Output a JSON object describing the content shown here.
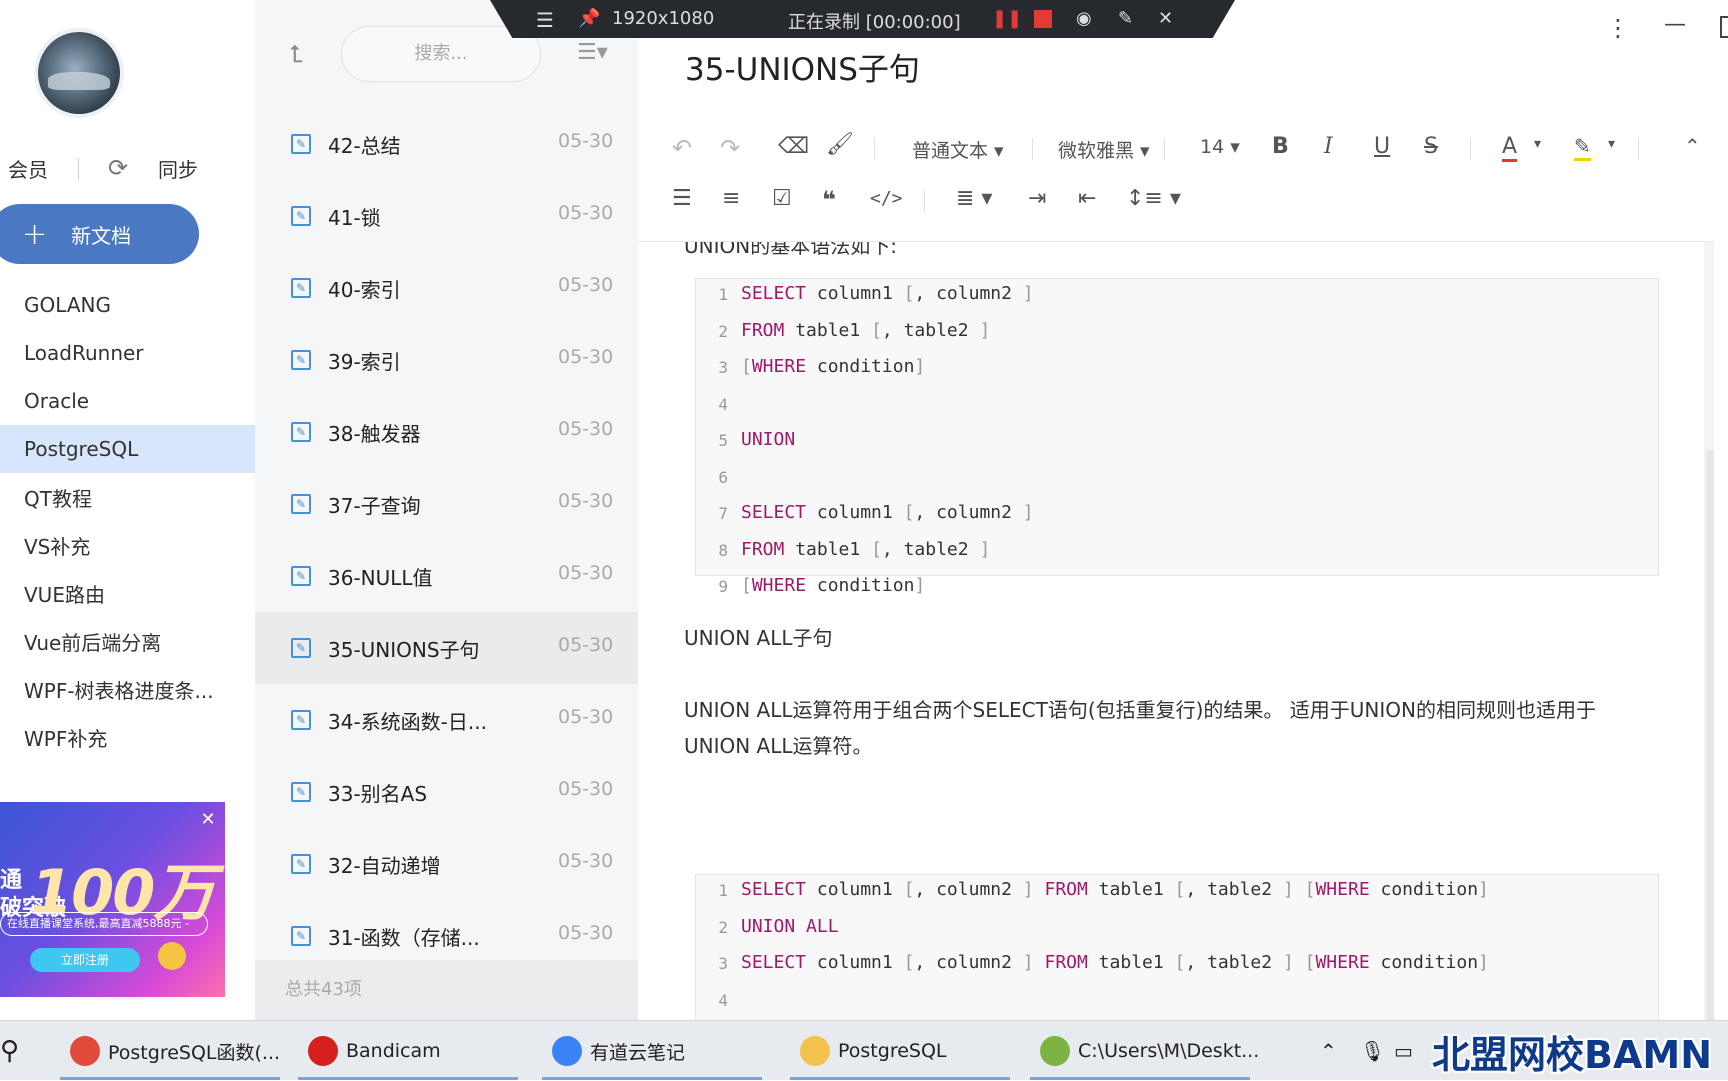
{
  "recorder": {
    "resolution": "1920x1080",
    "status": "正在录制 [00:00:00]"
  },
  "sidebar": {
    "member": "会员",
    "sync": "同步",
    "new_doc": "新文档",
    "notebooks": [
      {
        "label": "GOLANG",
        "selected": false
      },
      {
        "label": "LoadRunner",
        "selected": false
      },
      {
        "label": "Oracle",
        "selected": false
      },
      {
        "label": "PostgreSQL",
        "selected": true
      },
      {
        "label": "QT教程",
        "selected": false
      },
      {
        "label": "VS补充",
        "selected": false
      },
      {
        "label": "VUE路由",
        "selected": false
      },
      {
        "label": "Vue前后端分离",
        "selected": false
      },
      {
        "label": "WPF-树表格进度条...",
        "selected": false
      },
      {
        "label": "WPF补充",
        "selected": false
      }
    ],
    "ad": {
      "big": "100万",
      "line1": "通",
      "line2": "破突破",
      "small": "在线直播课堂系统,最高直减5888元 -",
      "button": "立即注册"
    }
  },
  "notelist": {
    "search_placeholder": "搜索...",
    "items": [
      {
        "title": "42-总结",
        "date": "05-30",
        "selected": false
      },
      {
        "title": "41-锁",
        "date": "05-30",
        "selected": false
      },
      {
        "title": "40-索引",
        "date": "05-30",
        "selected": false
      },
      {
        "title": "39-索引",
        "date": "05-30",
        "selected": false
      },
      {
        "title": "38-触发器",
        "date": "05-30",
        "selected": false
      },
      {
        "title": "37-子查询",
        "date": "05-30",
        "selected": false
      },
      {
        "title": "36-NULL值",
        "date": "05-30",
        "selected": false
      },
      {
        "title": "35-UNIONS子句",
        "date": "05-30",
        "selected": true
      },
      {
        "title": "34-系统函数-日...",
        "date": "05-30",
        "selected": false
      },
      {
        "title": "33-别名AS",
        "date": "05-30",
        "selected": false
      },
      {
        "title": "32-自动递增",
        "date": "05-30",
        "selected": false
      },
      {
        "title": "31-函数（存储...",
        "date": "05-30",
        "selected": false
      }
    ],
    "total": "总共43项"
  },
  "editor": {
    "title": "35-UNIONS子句",
    "toolbar": {
      "paragraph_style": "普通文本",
      "font": "微软雅黑",
      "font_size": "14",
      "bold": "B",
      "italic": "I",
      "underline": "U",
      "strike": "S",
      "color": "A"
    },
    "intro_partial": "UNION的基本语法如下:",
    "code1": [
      {
        "n": "1",
        "parts": [
          [
            "kw",
            "SELECT"
          ],
          [
            "t",
            " column1 "
          ],
          [
            "br",
            "["
          ],
          [
            "t",
            ", column2 "
          ],
          [
            "br",
            "]"
          ]
        ]
      },
      {
        "n": "2",
        "parts": [
          [
            "kw",
            "FROM"
          ],
          [
            "t",
            " table1 "
          ],
          [
            "br",
            "["
          ],
          [
            "t",
            ", table2 "
          ],
          [
            "br",
            "]"
          ]
        ]
      },
      {
        "n": "3",
        "parts": [
          [
            "br",
            "["
          ],
          [
            "kw",
            "WHERE"
          ],
          [
            "t",
            " condition"
          ],
          [
            "br",
            "]"
          ]
        ]
      },
      {
        "n": "4",
        "parts": []
      },
      {
        "n": "5",
        "parts": [
          [
            "kw",
            "UNION"
          ]
        ]
      },
      {
        "n": "6",
        "parts": []
      },
      {
        "n": "7",
        "parts": [
          [
            "kw",
            "SELECT"
          ],
          [
            "t",
            " column1 "
          ],
          [
            "br",
            "["
          ],
          [
            "t",
            ", column2 "
          ],
          [
            "br",
            "]"
          ]
        ]
      },
      {
        "n": "8",
        "parts": [
          [
            "kw",
            "FROM"
          ],
          [
            "t",
            " table1 "
          ],
          [
            "br",
            "["
          ],
          [
            "t",
            ", table2 "
          ],
          [
            "br",
            "]"
          ]
        ]
      },
      {
        "n": "9",
        "parts": [
          [
            "br",
            "["
          ],
          [
            "kw",
            "WHERE"
          ],
          [
            "t",
            " condition"
          ],
          [
            "br",
            "]"
          ]
        ]
      }
    ],
    "heading2": "UNION ALL子句",
    "para2_line1": "UNION ALL运算符用于组合两个SELECT语句(包括重复行)的结果。 适用于UNION的相同规则也适用于",
    "para2_line2": "UNION ALL运算符。",
    "code2": [
      {
        "n": "1",
        "parts": [
          [
            "kw",
            "SELECT"
          ],
          [
            "t",
            " column1 "
          ],
          [
            "br",
            "["
          ],
          [
            "t",
            ", column2 "
          ],
          [
            "br",
            "]"
          ],
          [
            "t",
            " "
          ],
          [
            "kw",
            "FROM"
          ],
          [
            "t",
            " table1 "
          ],
          [
            "br",
            "["
          ],
          [
            "t",
            ", table2 "
          ],
          [
            "br",
            "]"
          ],
          [
            "t",
            " "
          ],
          [
            "br",
            "["
          ],
          [
            "kw",
            "WHERE"
          ],
          [
            "t",
            " condition"
          ],
          [
            "br",
            "]"
          ]
        ]
      },
      {
        "n": "2",
        "parts": [
          [
            "kw",
            "UNION ALL"
          ]
        ]
      },
      {
        "n": "3",
        "parts": [
          [
            "kw",
            "SELECT"
          ],
          [
            "t",
            " column1 "
          ],
          [
            "br",
            "["
          ],
          [
            "t",
            ", column2 "
          ],
          [
            "br",
            "]"
          ],
          [
            "t",
            " "
          ],
          [
            "kw",
            "FROM"
          ],
          [
            "t",
            " table1 "
          ],
          [
            "br",
            "["
          ],
          [
            "t",
            ", table2 "
          ],
          [
            "br",
            "]"
          ],
          [
            "t",
            " "
          ],
          [
            "br",
            "["
          ],
          [
            "kw",
            "WHERE"
          ],
          [
            "t",
            " condition"
          ],
          [
            "br",
            "]"
          ]
        ]
      },
      {
        "n": "4",
        "parts": []
      }
    ]
  },
  "taskbar": {
    "items": [
      {
        "label": "PostgreSQL函数(...",
        "icon": "chrome-icon",
        "color": "#e04a3a"
      },
      {
        "label": "Bandicam",
        "icon": "bandicam-icon",
        "color": "#d62020"
      },
      {
        "label": "有道云笔记",
        "icon": "youdao-note-icon",
        "color": "#3b82f6"
      },
      {
        "label": "PostgreSQL",
        "icon": "folder-icon",
        "color": "#f2c14e"
      },
      {
        "label": "C:\\Users\\M\\Deskt...",
        "icon": "notepad-icon",
        "color": "#7cb342"
      }
    ],
    "watermark": "北盟网校BAMN"
  }
}
